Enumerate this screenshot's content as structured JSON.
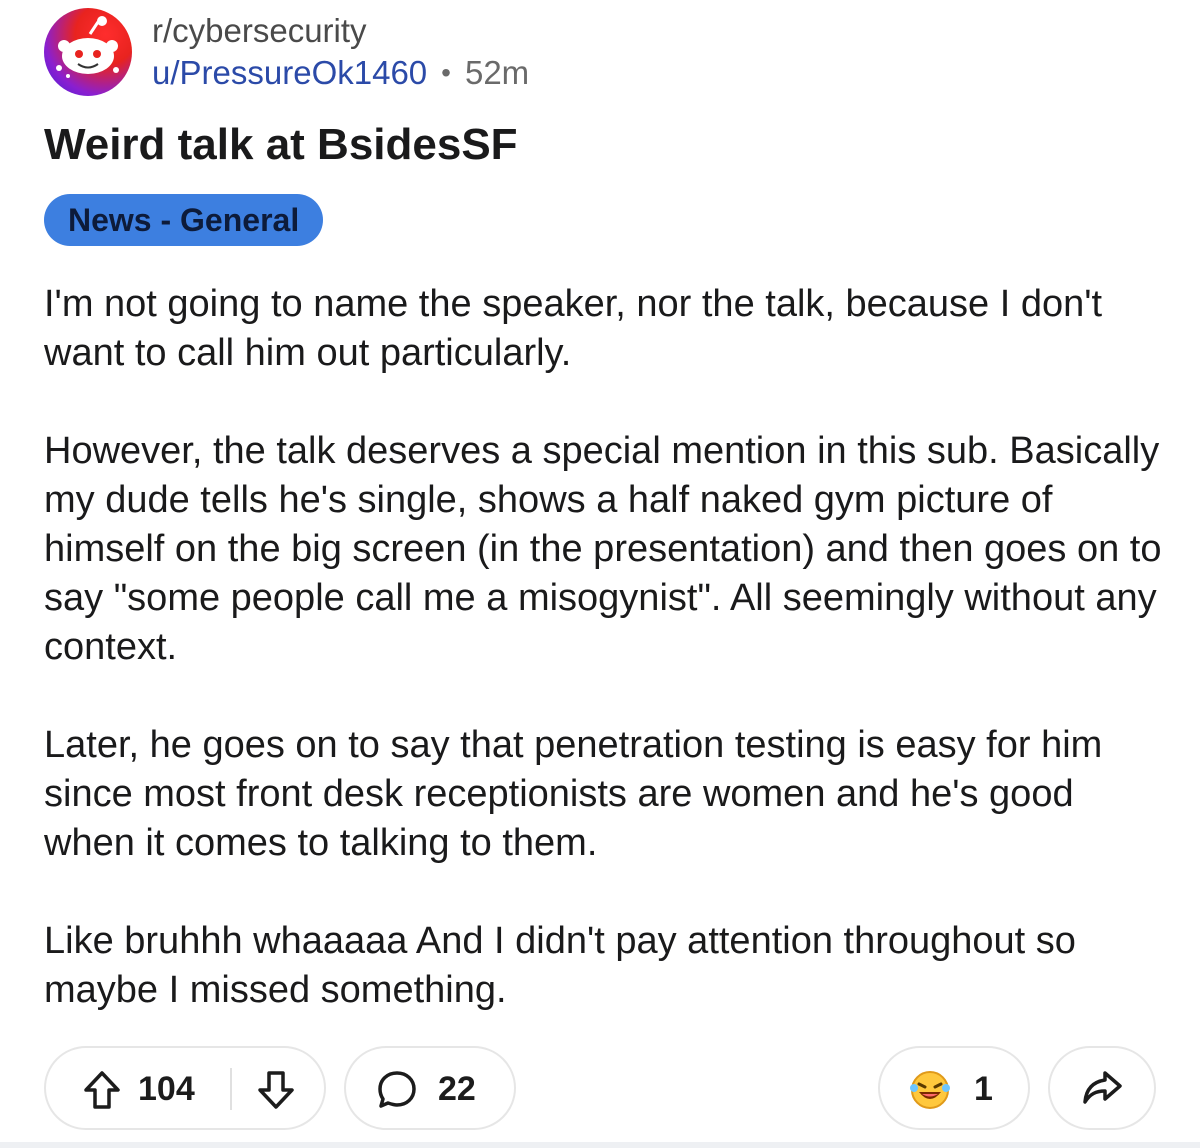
{
  "post": {
    "subreddit": "r/cybersecurity",
    "username": "u/PressureOk1460",
    "separator": "•",
    "age": "52m",
    "title": "Weird talk at BsidesSF",
    "flair": "News - General",
    "flair_color": "#3d7fe0",
    "body": [
      "I'm not going to name the speaker, nor the talk, because I don't want to call him out particularly.",
      "However, the talk deserves a special mention in this sub. Basically my dude tells he's single, shows a half naked gym picture of himself on the big screen (in the presentation) and then goes on to say \"some people call me a misogynist\". All seemingly without any context.",
      "Later, he goes on to say that penetration testing is easy for him since most front desk receptionists are women and he's good when it comes to talking to them.",
      "Like bruhhh whaaaaa And I didn't pay attention throughout so maybe I missed something."
    ]
  },
  "actions": {
    "upvote_icon": "arrow-up-icon",
    "vote_count": "104",
    "downvote_icon": "arrow-down-icon",
    "comment_icon": "speech-bubble-icon",
    "comment_count": "22",
    "award_icon": "laughing-emoji-icon",
    "award_count": "1",
    "share_icon": "share-arrow-icon"
  }
}
